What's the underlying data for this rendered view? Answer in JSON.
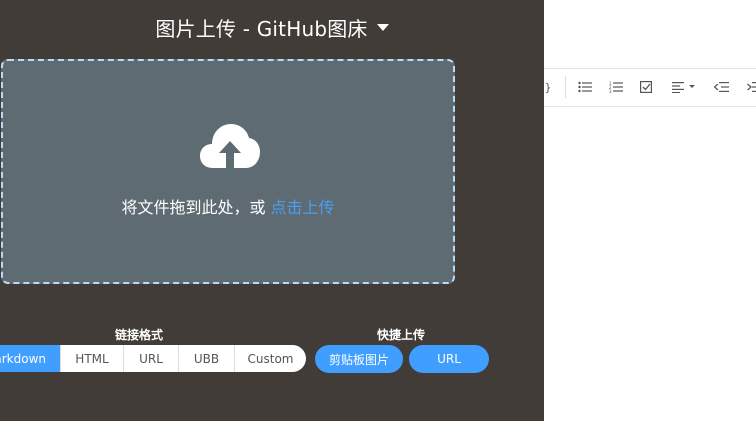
{
  "header": {
    "title": "图片上传 - GitHub图床",
    "dropdown_icon": "caret-down-icon"
  },
  "dropzone": {
    "icon": "cloud-upload-icon",
    "text": "将文件拖到此处，或 ",
    "link_text": "点击上传"
  },
  "link_format": {
    "label": "链接格式",
    "options": [
      "Markdown",
      "HTML",
      "URL",
      "UBB",
      "Custom"
    ],
    "selected": "Markdown"
  },
  "quick_upload": {
    "label": "快捷上传",
    "buttons": [
      "剪贴板图片",
      "URL"
    ]
  },
  "editor_toolbar": {
    "icons": [
      "brace-icon",
      "unordered-list-icon",
      "ordered-list-icon",
      "checkbox-icon",
      "align-left-icon",
      "outdent-icon",
      "indent-icon"
    ]
  },
  "colors": {
    "panel_bg": "#413c37",
    "dropzone_bg": "#5f6b73",
    "accent": "#409eff",
    "link": "#4a9eee"
  }
}
